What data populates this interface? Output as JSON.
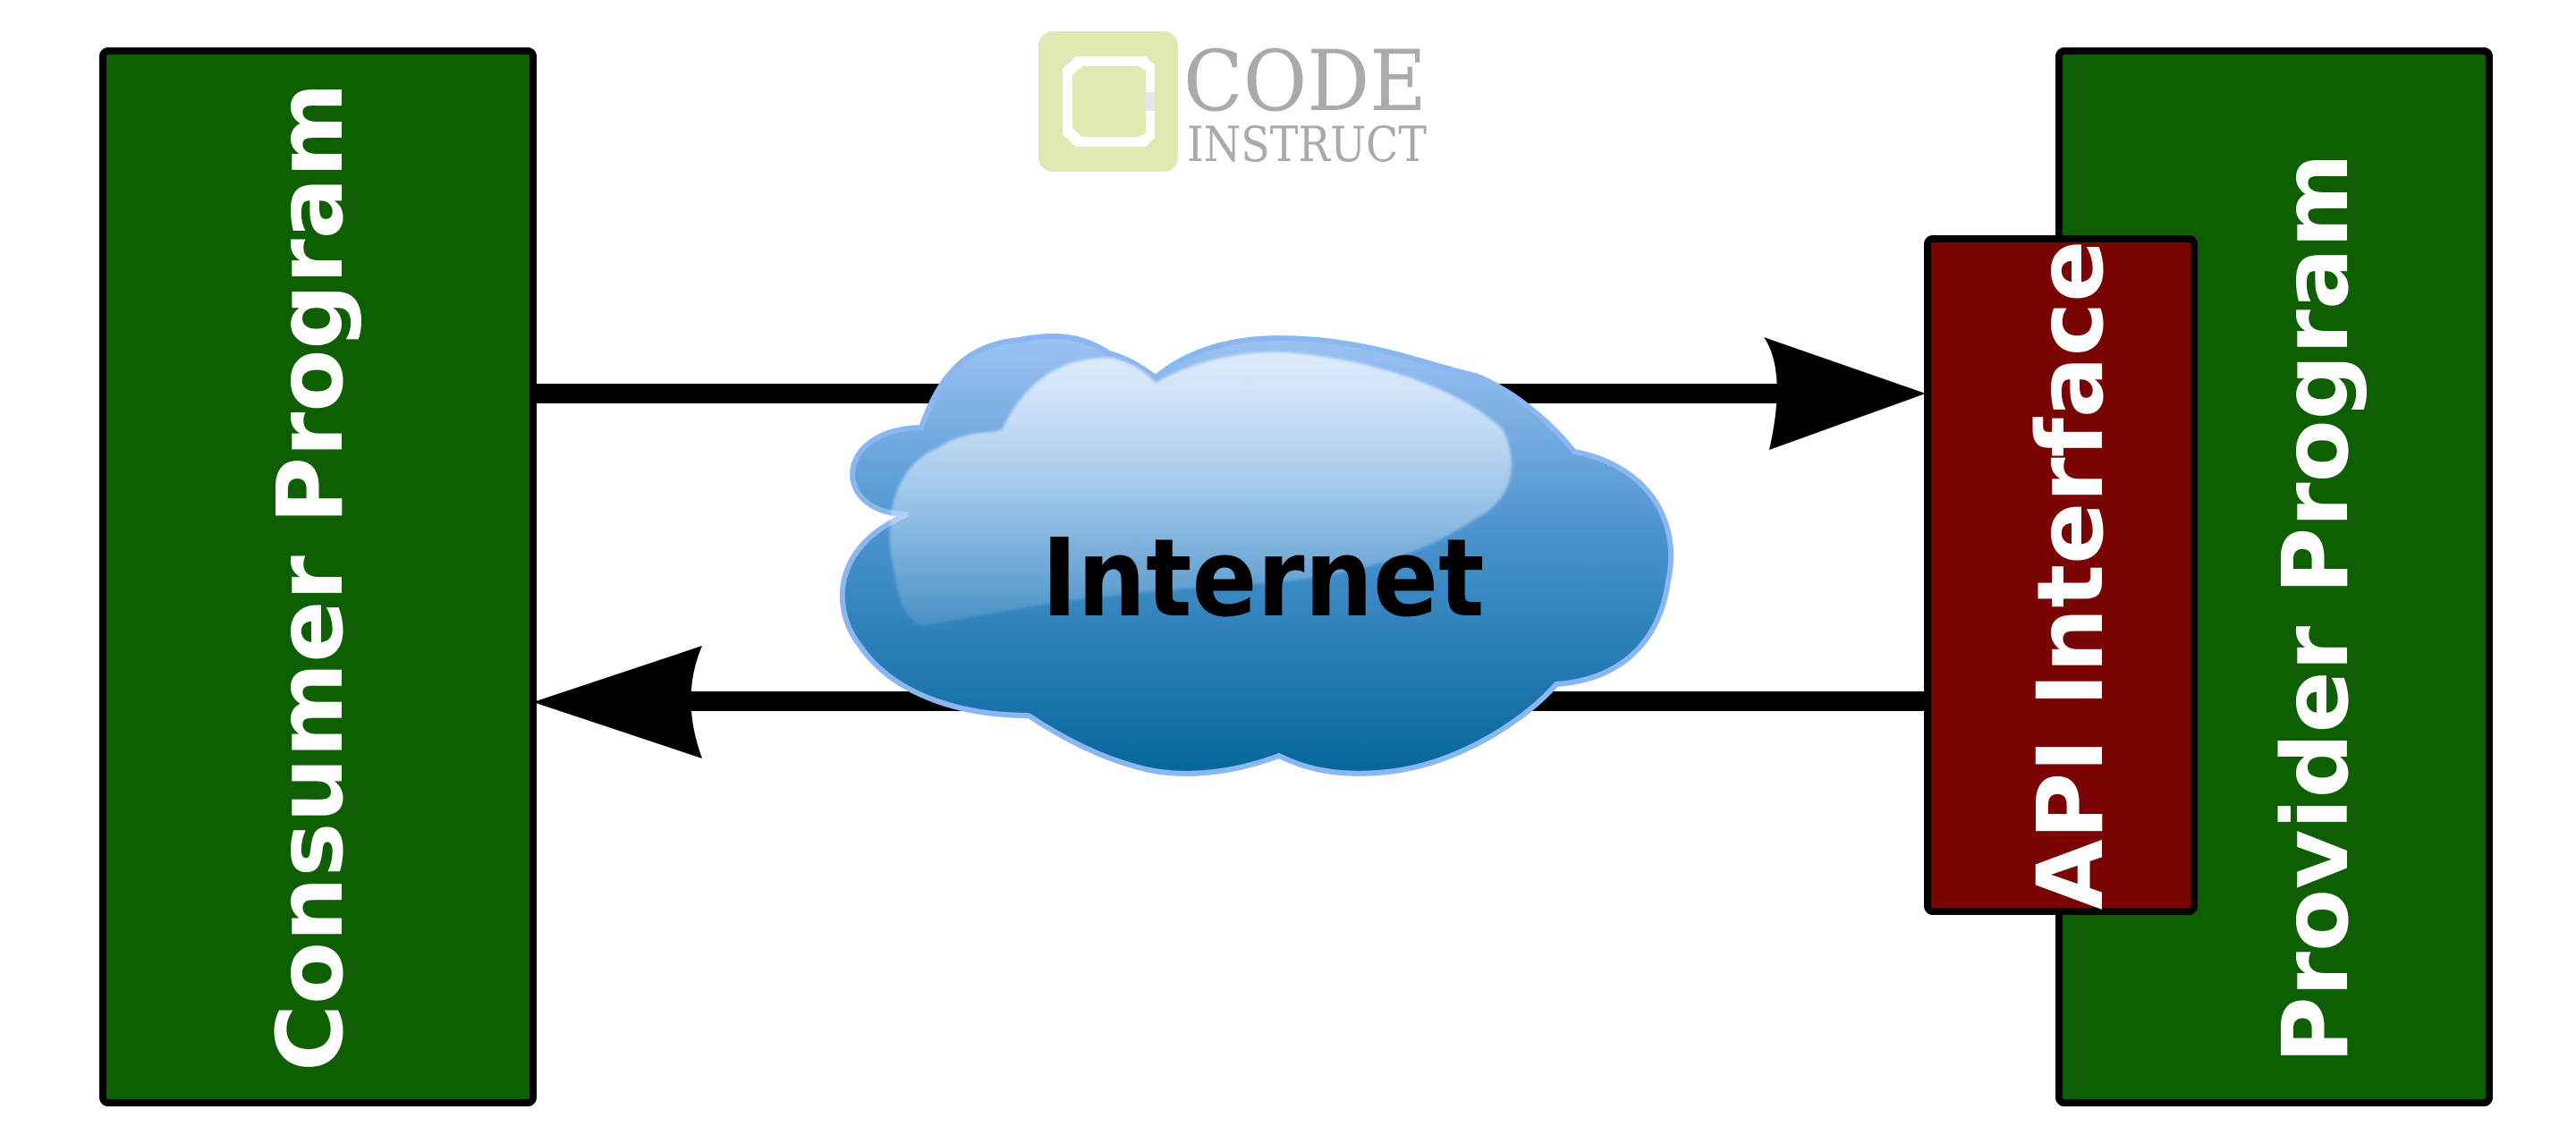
{
  "logo": {
    "line1": "CODE",
    "line2": "INSTRUCT",
    "icon": "code-institute-logo-icon",
    "badge_color": "#dfeab3",
    "text_color": "#aaaaaa"
  },
  "nodes": {
    "consumer": {
      "label": "Consumer Program",
      "color": "#0e5e02"
    },
    "provider": {
      "label": "Provider Program",
      "color": "#0e5e02"
    },
    "api": {
      "label": "API Interface",
      "color": "#7a0303"
    },
    "internet": {
      "label": "Internet",
      "icon": "cloud-icon"
    }
  },
  "edges": [
    {
      "from": "consumer",
      "to": "api",
      "direction": "right",
      "via": "internet"
    },
    {
      "from": "api",
      "to": "consumer",
      "direction": "left",
      "via": "internet"
    }
  ]
}
